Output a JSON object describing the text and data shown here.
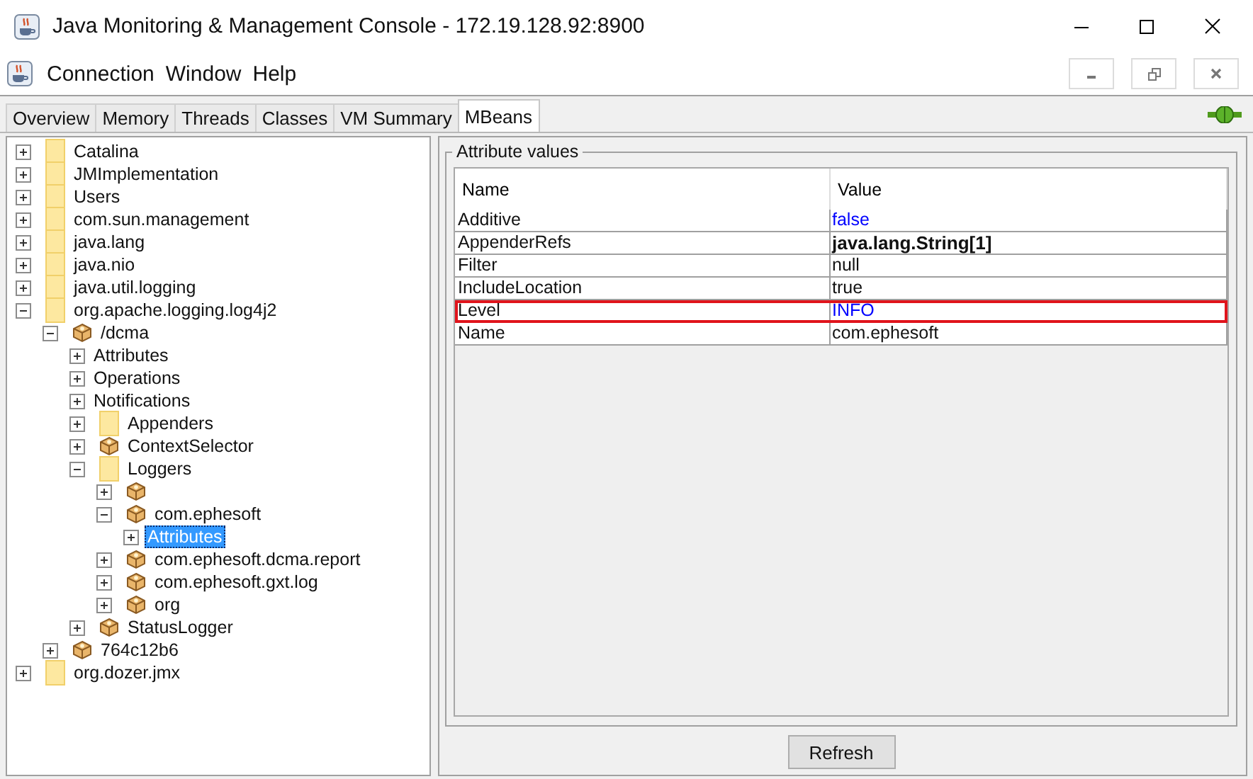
{
  "window": {
    "title": "Java Monitoring & Management Console - 172.19.128.92:8900"
  },
  "menu": [
    "Connection",
    "Window",
    "Help"
  ],
  "tabs": [
    {
      "label": "Overview",
      "selected": false
    },
    {
      "label": "Memory",
      "selected": false
    },
    {
      "label": "Threads",
      "selected": false
    },
    {
      "label": "Classes",
      "selected": false
    },
    {
      "label": "VM Summary",
      "selected": false
    },
    {
      "label": "MBeans",
      "selected": true
    }
  ],
  "tree": [
    {
      "label": "Catalina",
      "kind": "folder",
      "expanded": false,
      "selected": false
    },
    {
      "label": "JMImplementation",
      "kind": "folder",
      "expanded": false,
      "selected": false
    },
    {
      "label": "Users",
      "kind": "folder",
      "expanded": false,
      "selected": false
    },
    {
      "label": "com.sun.management",
      "kind": "folder",
      "expanded": false,
      "selected": false
    },
    {
      "label": "java.lang",
      "kind": "folder",
      "expanded": false,
      "selected": false
    },
    {
      "label": "java.nio",
      "kind": "folder",
      "expanded": false,
      "selected": false
    },
    {
      "label": "java.util.logging",
      "kind": "folder",
      "expanded": false,
      "selected": false
    },
    {
      "label": "org.apache.logging.log4j2",
      "kind": "folder",
      "expanded": true,
      "selected": false,
      "children": [
        {
          "label": "/dcma",
          "kind": "bean",
          "expanded": true,
          "selected": false,
          "children": [
            {
              "label": "Attributes",
              "kind": "plain",
              "expanded": false,
              "selected": false
            },
            {
              "label": "Operations",
              "kind": "plain",
              "expanded": false,
              "selected": false
            },
            {
              "label": "Notifications",
              "kind": "plain",
              "expanded": false,
              "selected": false
            },
            {
              "label": "Appenders",
              "kind": "folder",
              "expanded": false,
              "selected": false
            },
            {
              "label": "ContextSelector",
              "kind": "bean",
              "expanded": false,
              "selected": false
            },
            {
              "label": "Loggers",
              "kind": "folder",
              "expanded": true,
              "selected": false,
              "children": [
                {
                  "kind": "bean",
                  "expanded": false,
                  "selected": false
                },
                {
                  "label": "com.ephesoft",
                  "kind": "bean",
                  "expanded": true,
                  "selected": false,
                  "children": [
                    {
                      "label": "Attributes",
                      "kind": "plain",
                      "expanded": false,
                      "selected": true
                    }
                  ]
                },
                {
                  "label": "com.ephesoft.dcma.report",
                  "kind": "bean",
                  "expanded": false,
                  "selected": false
                },
                {
                  "label": "com.ephesoft.gxt.log",
                  "kind": "bean",
                  "expanded": false,
                  "selected": false
                },
                {
                  "label": "org",
                  "kind": "bean",
                  "expanded": false,
                  "selected": false
                }
              ]
            },
            {
              "label": "StatusLogger",
              "kind": "bean",
              "expanded": false,
              "selected": false
            }
          ]
        },
        {
          "label": "764c12b6",
          "kind": "bean",
          "expanded": false,
          "selected": false
        }
      ]
    },
    {
      "label": "org.dozer.jmx",
      "kind": "folder",
      "expanded": false,
      "selected": false
    }
  ],
  "attributes": {
    "title": "Attribute values",
    "columns": [
      "Name",
      "Value"
    ],
    "rows": [
      {
        "name": "Additive",
        "value": "false",
        "kind": "editable",
        "highlighted": false
      },
      {
        "name": "AppenderRefs",
        "value": "java.lang.String[1]",
        "kind": "array",
        "highlighted": false
      },
      {
        "name": "Filter",
        "value": "null",
        "kind": "plain",
        "highlighted": false
      },
      {
        "name": "IncludeLocation",
        "value": "true",
        "kind": "plain",
        "highlighted": false
      },
      {
        "name": "Level",
        "value": "INFO",
        "kind": "editable",
        "highlighted": true
      },
      {
        "name": "Name",
        "value": "com.ephesoft",
        "kind": "plain",
        "highlighted": false
      }
    ]
  },
  "refresh_button": "Refresh"
}
